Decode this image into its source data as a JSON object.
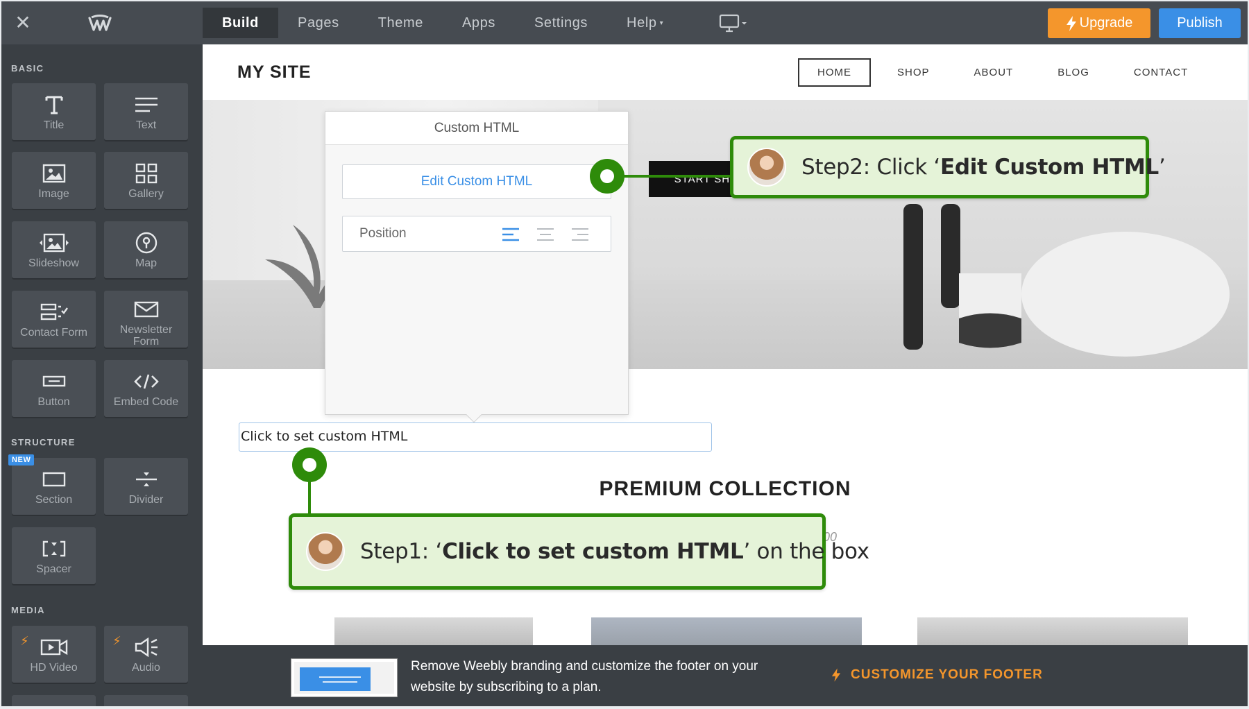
{
  "topbar": {
    "nav": [
      {
        "label": "Build",
        "active": true
      },
      {
        "label": "Pages"
      },
      {
        "label": "Theme"
      },
      {
        "label": "Apps"
      },
      {
        "label": "Settings"
      },
      {
        "label": "Help",
        "caret": true
      }
    ],
    "upgrade_label": "Upgrade",
    "publish_label": "Publish"
  },
  "sidebar": {
    "sections": {
      "basic": "BASIC",
      "structure": "STRUCTURE",
      "media": "MEDIA"
    },
    "new_badge": "NEW",
    "tiles": {
      "title": "Title",
      "text": "Text",
      "image": "Image",
      "gallery": "Gallery",
      "slideshow": "Slideshow",
      "map": "Map",
      "contact_form": "Contact Form",
      "newsletter_form_1": "Newsletter",
      "newsletter_form_2": "Form",
      "button": "Button",
      "embed_code": "Embed Code",
      "section": "Section",
      "divider": "Divider",
      "spacer": "Spacer",
      "hd_video": "HD Video",
      "audio": "Audio"
    }
  },
  "site": {
    "title": "MY SITE",
    "nav": [
      "HOME",
      "SHOP",
      "ABOUT",
      "BLOG",
      "CONTACT"
    ],
    "hero_button": "START SHOPPING",
    "section_title": "PREMIUM COLLECTION",
    "price_fragment": "00",
    "html_placeholder": "Click to set custom HTML"
  },
  "popup": {
    "title": "Custom HTML",
    "edit_button": "Edit Custom HTML",
    "position_label": "Position"
  },
  "footer": {
    "text": "Remove Weebly branding and customize the footer on your website by subscribing to a plan.",
    "cta": "CUSTOMIZE YOUR FOOTER"
  },
  "guide": {
    "step1": {
      "prefix": "Step1: ‘",
      "bold": "Click to set custom HTML",
      "suffix": "’ on the box"
    },
    "step2": {
      "prefix": "Step2: Click ‘",
      "bold": "Edit Custom HTML",
      "suffix": "’"
    }
  },
  "colors": {
    "topbar": "#464b51",
    "sidebar": "#3a3f44",
    "upgrade": "#f4962c",
    "publish": "#3a8fe6",
    "guide_green": "#2e8b0a",
    "callout_bg": "#e5f3d8"
  }
}
